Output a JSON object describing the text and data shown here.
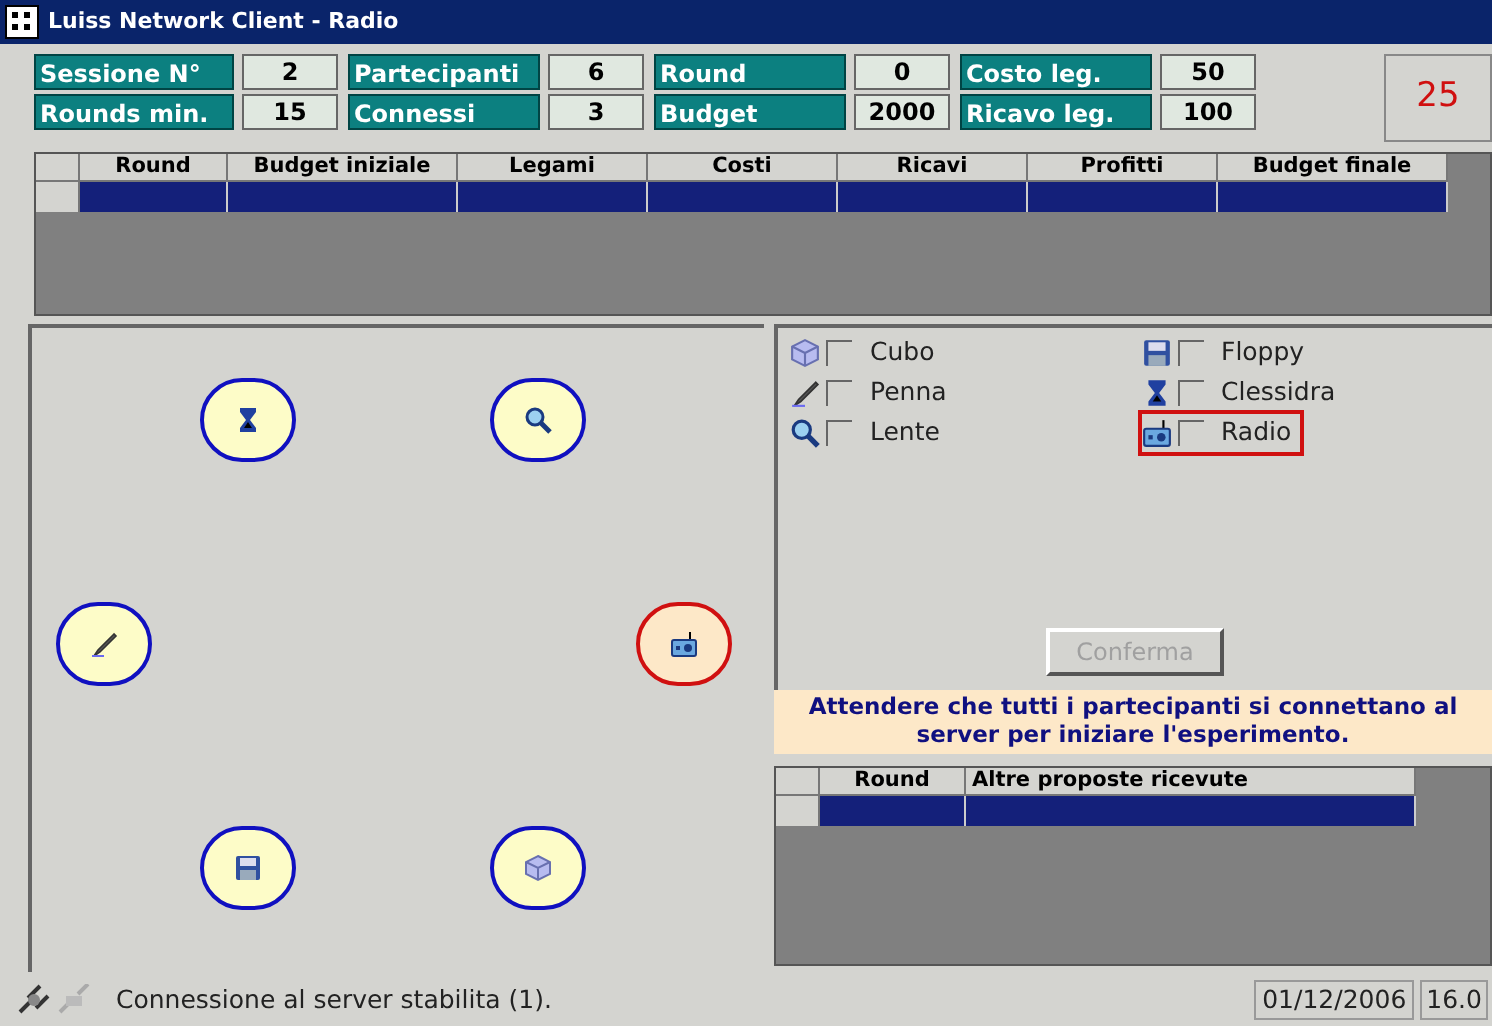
{
  "window": {
    "title": "Luiss Network Client - Radio"
  },
  "stats": [
    [
      {
        "label": "Sessione N°",
        "value": "2"
      },
      {
        "label": "Partecipanti",
        "value": "6"
      },
      {
        "label": "Round",
        "value": "0"
      },
      {
        "label": "Costo leg.",
        "value": "50"
      }
    ],
    [
      {
        "label": "Rounds min.",
        "value": "15"
      },
      {
        "label": "Connessi",
        "value": "3"
      },
      {
        "label": "Budget",
        "value": "2000"
      },
      {
        "label": "Ricavo leg.",
        "value": "100"
      }
    ]
  ],
  "counter": "25",
  "results_table": {
    "columns": [
      "Round",
      "Budget iniziale",
      "Legami",
      "Costi",
      "Ricavi",
      "Profitti",
      "Budget finale"
    ]
  },
  "network_nodes": [
    {
      "kind": "hourglass",
      "self": false
    },
    {
      "kind": "lens",
      "self": false
    },
    {
      "kind": "pen",
      "self": false
    },
    {
      "kind": "radio",
      "self": true
    },
    {
      "kind": "floppy",
      "self": false
    },
    {
      "kind": "cube",
      "self": false
    }
  ],
  "objects": [
    {
      "kind": "cube",
      "label": "Cubo",
      "checked": false,
      "selected": false
    },
    {
      "kind": "floppy",
      "label": "Floppy",
      "checked": false,
      "selected": false
    },
    {
      "kind": "pen",
      "label": "Penna",
      "checked": false,
      "selected": false
    },
    {
      "kind": "hourglass",
      "label": "Clessidra",
      "checked": false,
      "selected": false
    },
    {
      "kind": "lens",
      "label": "Lente",
      "checked": false,
      "selected": false
    },
    {
      "kind": "radio",
      "label": "Radio",
      "checked": false,
      "selected": true
    }
  ],
  "confirm_button": {
    "label": "Conferma",
    "disabled": true
  },
  "message": "Attendere che tutti i partecipanti si connettano al server per iniziare l'esperimento.",
  "proposals_table": {
    "columns": [
      "Round",
      "Altre proposte ricevute"
    ]
  },
  "status_bar": {
    "text": "Connessione al server stabilita (1).",
    "date": "01/12/2006",
    "time": "16.0"
  }
}
